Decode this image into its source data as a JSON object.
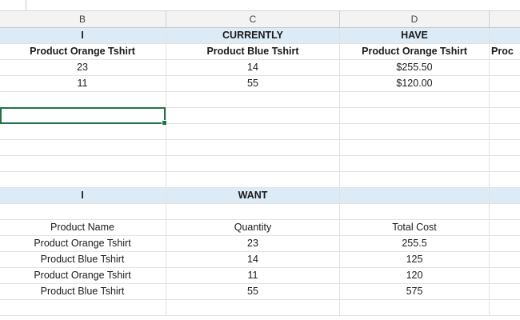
{
  "columns": [
    "B",
    "C",
    "D"
  ],
  "rows": [
    {
      "band": true,
      "bold": true,
      "cells": [
        "I",
        "CURRENTLY",
        "HAVE",
        ""
      ]
    },
    {
      "band": false,
      "bold": true,
      "cells": [
        "Product Orange Tshirt",
        "Product Blue Tshirt",
        "Product Orange Tshirt",
        "Proc"
      ]
    },
    {
      "band": false,
      "bold": false,
      "cells": [
        "23",
        "14",
        "$255.50",
        ""
      ]
    },
    {
      "band": false,
      "bold": false,
      "cells": [
        "11",
        "55",
        "$120.00",
        ""
      ]
    },
    {
      "band": false,
      "bold": false,
      "cells": [
        "",
        "",
        "",
        ""
      ]
    },
    {
      "band": false,
      "bold": false,
      "cells": [
        "",
        "",
        "",
        ""
      ]
    },
    {
      "band": false,
      "bold": false,
      "cells": [
        "",
        "",
        "",
        ""
      ]
    },
    {
      "band": false,
      "bold": false,
      "cells": [
        "",
        "",
        "",
        ""
      ]
    },
    {
      "band": false,
      "bold": false,
      "cells": [
        "",
        "",
        "",
        ""
      ]
    },
    {
      "band": false,
      "bold": false,
      "cells": [
        "",
        "",
        "",
        ""
      ]
    },
    {
      "band": true,
      "bold": true,
      "cells": [
        "I",
        "WANT",
        "",
        ""
      ]
    },
    {
      "band": false,
      "bold": false,
      "cells": [
        "",
        "",
        "",
        ""
      ]
    },
    {
      "band": false,
      "bold": false,
      "cells": [
        "Product Name",
        "Quantity",
        "Total Cost",
        ""
      ]
    },
    {
      "band": false,
      "bold": false,
      "cells": [
        "Product Orange Tshirt",
        "23",
        "255.5",
        ""
      ]
    },
    {
      "band": false,
      "bold": false,
      "cells": [
        "Product Blue Tshirt",
        "14",
        "125",
        ""
      ]
    },
    {
      "band": false,
      "bold": false,
      "cells": [
        "Product Orange Tshirt",
        "11",
        "120",
        ""
      ]
    },
    {
      "band": false,
      "bold": false,
      "cells": [
        "Product Blue Tshirt",
        "55",
        "575",
        ""
      ]
    },
    {
      "band": false,
      "bold": false,
      "cells": [
        "",
        "",
        "",
        ""
      ]
    }
  ],
  "colors": {
    "header_band": "#ddebf7",
    "selection": "#217346"
  }
}
